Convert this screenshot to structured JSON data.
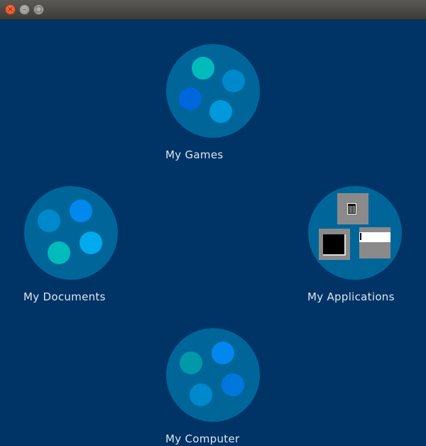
{
  "window": {
    "close_icon": "×",
    "minimize_icon": "–",
    "maximize_icon": "□"
  },
  "desktop": {
    "background": "#003366",
    "folder_color": "#006699",
    "folders": [
      {
        "id": "games",
        "label": "My Games",
        "dot_colors": [
          "#00bbbb",
          "#0088cc",
          "#0066dd",
          "#0099dd"
        ]
      },
      {
        "id": "documents",
        "label": "My Documents",
        "dot_colors": [
          "#0088cc",
          "#0088ee",
          "#00aaee",
          "#00bbbb"
        ]
      },
      {
        "id": "applications",
        "label": "My Applications",
        "icon": "application-thumbnails-icon"
      },
      {
        "id": "computer",
        "label": "My Computer",
        "dot_colors": [
          "#0099aa",
          "#0088ee",
          "#0088cc",
          "#0077dd"
        ]
      }
    ]
  }
}
